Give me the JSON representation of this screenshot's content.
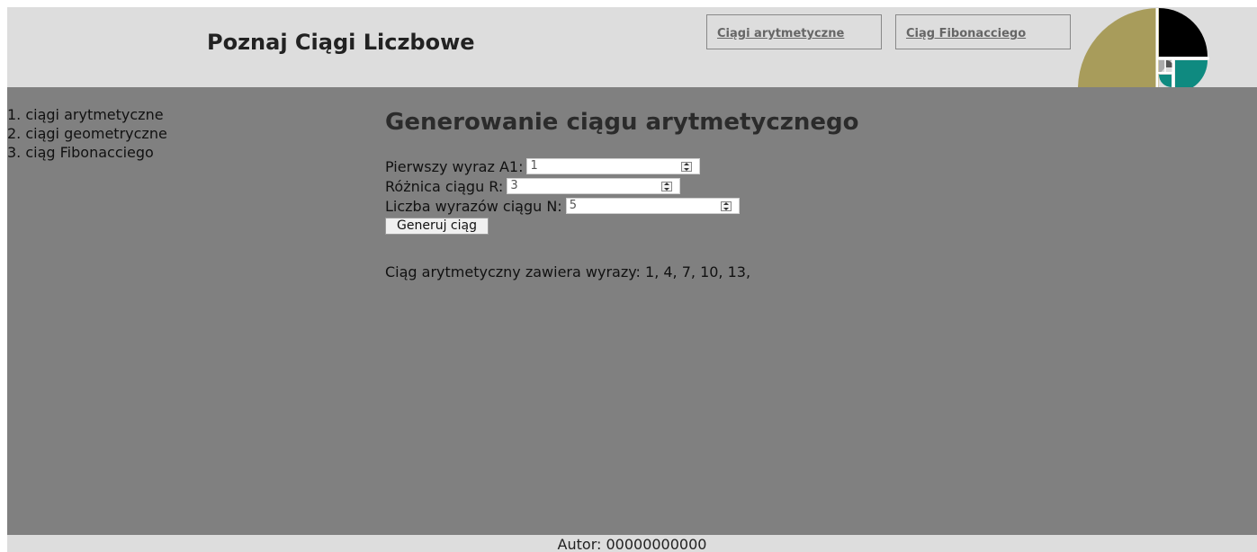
{
  "header": {
    "title": "Poznaj Ciągi Liczbowe",
    "links": [
      "Ciągi arytmetyczne",
      "Ciąg Fibonacciego"
    ]
  },
  "sidebar": {
    "items": [
      "1. ciągi arytmetyczne",
      "2. ciągi geometryczne",
      "3. ciąg Fibonacciego"
    ]
  },
  "main": {
    "heading": "Generowanie ciągu arytmetycznego",
    "fields": [
      {
        "label": "Pierwszy wyraz A1:",
        "value": "1"
      },
      {
        "label": "Różnica ciągu R:",
        "value": "3"
      },
      {
        "label": "Liczba wyrazów ciągu N:",
        "value": "5"
      }
    ],
    "button": "Generuj ciąg",
    "result": "Ciąg arytmetyczny zawiera wyrazy: 1, 4, 7, 10, 13,"
  },
  "footer": {
    "text": "Autor: 00000000000"
  },
  "colors": {
    "header_bg": "#dddddd",
    "content_bg": "#808080",
    "logo_gold": "#a89c5b",
    "logo_black": "#000000",
    "logo_teal": "#0f8a80"
  },
  "logo": {
    "icon": "fibonacci-spiral-logo"
  }
}
